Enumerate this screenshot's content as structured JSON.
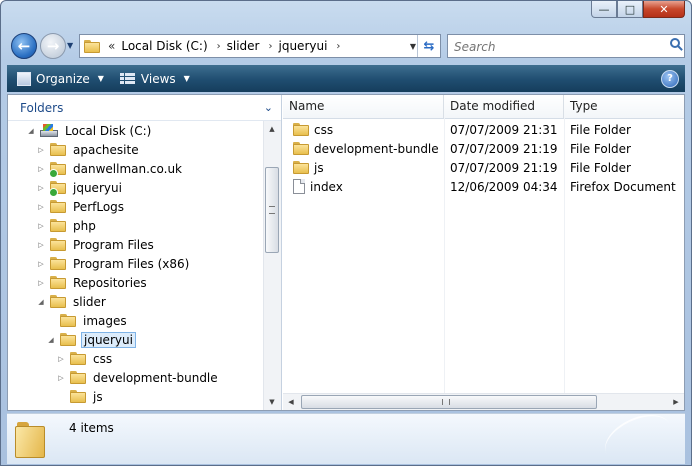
{
  "window": {
    "caption_buttons": {
      "minimize": "—",
      "maximize": "□",
      "close": "✕"
    }
  },
  "nav": {
    "back_icon": "back-arrow-icon",
    "forward_icon": "forward-arrow-icon"
  },
  "address": {
    "chevron": "«",
    "crumbs": [
      "Local Disk (C:)",
      "slider",
      "jqueryui"
    ],
    "separator": "›"
  },
  "search": {
    "placeholder": "Search"
  },
  "commandbar": {
    "organize_label": "Organize",
    "views_label": "Views",
    "help_label": "?"
  },
  "navpane": {
    "header": "Folders",
    "tree": [
      {
        "label": "Local Disk (C:)",
        "icon": "drive-icon",
        "expander": "open"
      },
      {
        "label": "apachesite",
        "icon": "folder-icon",
        "expander": "closed"
      },
      {
        "label": "danwellman.co.uk",
        "icon": "folder-sync-icon",
        "expander": "closed"
      },
      {
        "label": "jqueryui",
        "icon": "folder-sync-icon",
        "expander": "closed"
      },
      {
        "label": "PerfLogs",
        "icon": "folder-icon",
        "expander": "closed"
      },
      {
        "label": "php",
        "icon": "folder-icon",
        "expander": "closed"
      },
      {
        "label": "Program Files",
        "icon": "folder-icon",
        "expander": "closed"
      },
      {
        "label": "Program Files (x86)",
        "icon": "folder-icon",
        "expander": "closed"
      },
      {
        "label": "Repositories",
        "icon": "folder-icon",
        "expander": "closed"
      },
      {
        "label": "slider",
        "icon": "folder-icon",
        "expander": "open"
      },
      {
        "label": "images",
        "icon": "folder-icon",
        "expander": "none"
      },
      {
        "label": "jqueryui",
        "icon": "folder-icon",
        "expander": "open",
        "selected": true
      },
      {
        "label": "css",
        "icon": "folder-icon",
        "expander": "closed"
      },
      {
        "label": "development-bundle",
        "icon": "folder-icon",
        "expander": "closed"
      },
      {
        "label": "js",
        "icon": "folder-icon",
        "expander": "none"
      }
    ]
  },
  "filelist": {
    "columns": [
      "Name",
      "Date modified",
      "Type"
    ],
    "rows": [
      {
        "name": "css",
        "date": "07/07/2009 21:31",
        "type": "File Folder",
        "icon": "folder-icon"
      },
      {
        "name": "development-bundle",
        "date": "07/07/2009 21:19",
        "type": "File Folder",
        "icon": "folder-icon"
      },
      {
        "name": "js",
        "date": "07/07/2009 21:19",
        "type": "File Folder",
        "icon": "folder-icon"
      },
      {
        "name": "index",
        "date": "12/06/2009 04:34",
        "type": "Firefox Document",
        "icon": "document-icon"
      }
    ]
  },
  "details": {
    "item_count": "4 items"
  }
}
